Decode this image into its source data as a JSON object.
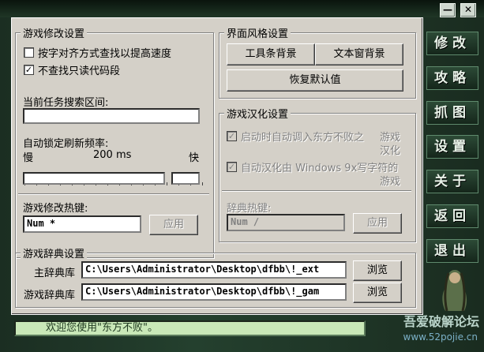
{
  "titlebar": {
    "minimize": "—",
    "close": "✕"
  },
  "mod_settings": {
    "title": "游戏修改设置",
    "align_check": {
      "label": "按字对齐方式查找以提高速度",
      "checked": false
    },
    "readonly_check": {
      "label": "不查找只读代码段",
      "checked": true
    },
    "search_range_label": "当前任务搜索区间:",
    "search_range_value": "",
    "refresh_label": "自动锁定刷新频率:",
    "slow": "慢",
    "fast": "快",
    "freq": "200 ms",
    "hotkey_label": "游戏修改热键:",
    "hotkey_value": "Num *",
    "apply": "应用"
  },
  "style_settings": {
    "title": "界面风格设置",
    "toolbar_bg": "工具条背景",
    "textwin_bg": "文本窗背景",
    "restore": "恢复默认值"
  },
  "localization": {
    "title": "游戏汉化设置",
    "auto_load": {
      "label1": "启动时自动调入东方不败之",
      "label2": "游戏",
      "label3": "汉化",
      "checked": true
    },
    "auto_hanhua": {
      "label1": "自动汉化由 Windows 9x写字符的",
      "label2": "游戏",
      "checked": true
    },
    "dict_hotkey_label": "辞典热键:",
    "dict_hotkey_value": "Num /",
    "apply": "应用"
  },
  "dictionary": {
    "title": "游戏辞典设置",
    "main_label": "主辞典库",
    "main_value": "C:\\Users\\Administrator\\Desktop\\dfbb\\!_ext",
    "game_label": "游戏辞典库",
    "game_value": "C:\\Users\\Administrator\\Desktop\\dfbb\\!_gam",
    "browse": "浏览"
  },
  "sidebar": {
    "items": [
      "修改",
      "攻略",
      "抓图",
      "设置",
      "关于",
      "返回",
      "退出"
    ]
  },
  "status": "欢迎您使用\"东方不败\"。",
  "watermark": {
    "line1": "吾爱破解论坛",
    "line2": "www.52pojie.cn"
  }
}
